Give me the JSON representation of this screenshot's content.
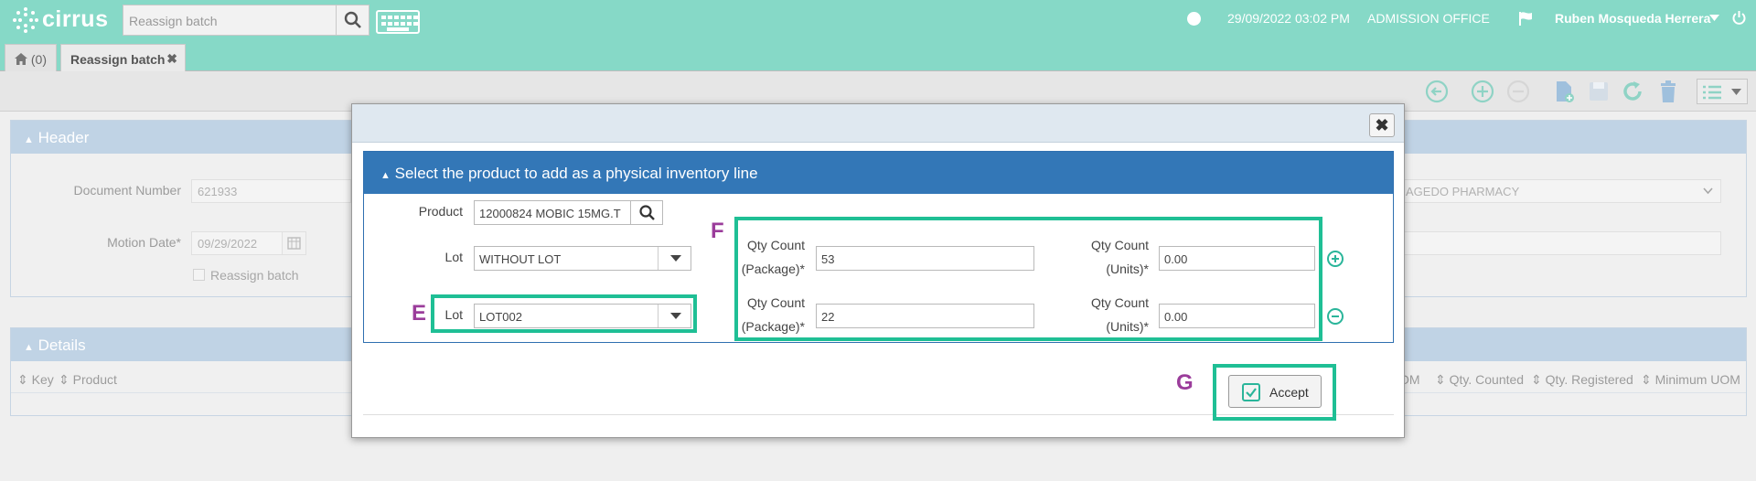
{
  "app": {
    "name": "cirrus"
  },
  "topbar": {
    "search_placeholder": "Reassign batch",
    "datetime": "29/09/2022 03:02 PM",
    "office": "ADMISSION OFFICE",
    "user": "Ruben Mosqueda Herrera",
    "accent_color": "#86d9c7"
  },
  "tabs": [
    {
      "label": "(0)"
    },
    {
      "label": "Reassign batch"
    }
  ],
  "header_panel": {
    "title": "Header",
    "document_number_label": "Document Number",
    "document_number_value": "621933",
    "motion_date_label": "Motion Date*",
    "motion_date_value": "09/29/2022",
    "reassign_label": "Reassign batch",
    "pharmacy_value": "AGEDO PHARMACY"
  },
  "details_panel": {
    "title": "Details",
    "columns_left": [
      "Key",
      "Product"
    ],
    "columns_right": [
      "OM",
      "Qty. Counted",
      "Qty. Registered",
      "Minimum UOM"
    ]
  },
  "modal": {
    "section_title": "Select the product to add as a physical inventory line",
    "product_label": "Product",
    "product_value": "12000824 MOBIC 15MG.T",
    "lot_label": "Lot",
    "lot1_value": "WITHOUT LOT",
    "lot2_value": "LOT002",
    "qty_package_label_1": "Qty Count",
    "qty_package_label_2": "(Package)*",
    "qty_units_label_1": "Qty Count",
    "qty_units_label_2": "(Units)*",
    "row1_package": "53",
    "row1_units": "0.00",
    "row2_package": "22",
    "row2_units": "0.00",
    "accept_label": "Accept"
  },
  "callouts": {
    "e": "E",
    "f": "F",
    "g": "G"
  }
}
